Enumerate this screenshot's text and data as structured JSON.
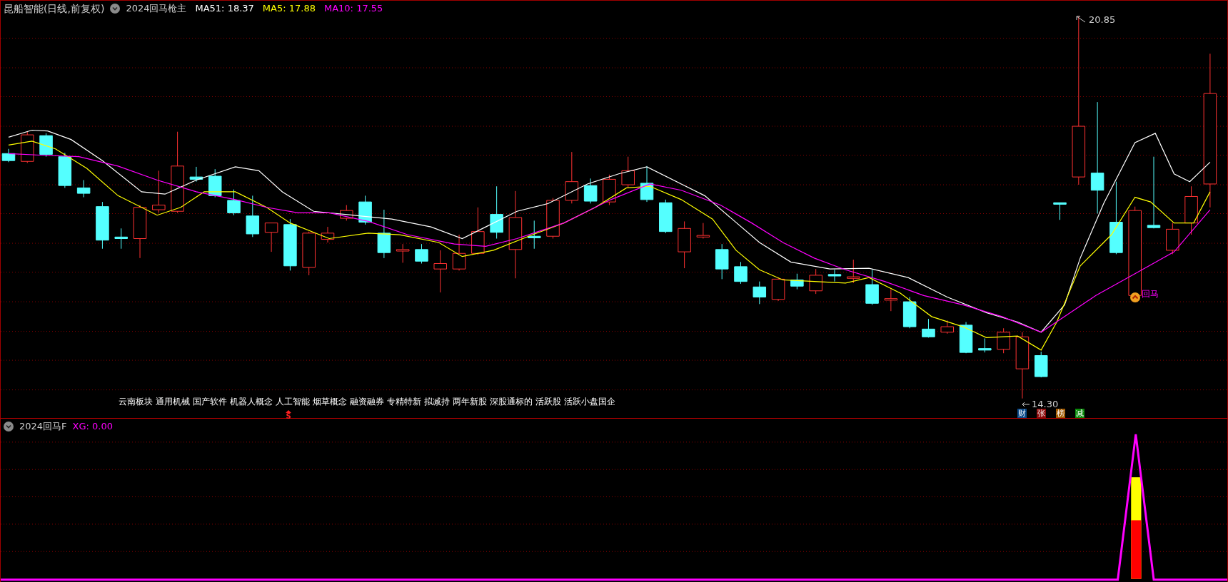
{
  "main_pane": {
    "title": "昆船智能(日线,前复权)",
    "indicator": "2024回马枪主",
    "legend": [
      {
        "label": "MA51: 18.37",
        "color": "#ffffff"
      },
      {
        "label": "MA5: 17.88",
        "color": "#ffff00"
      },
      {
        "label": "MA10: 17.55",
        "color": "#ff00ff"
      }
    ],
    "high_label": "20.85",
    "low_label": "14.30",
    "signal_label": "回马",
    "concepts": [
      "云南板块",
      "通用机械",
      "国产软件",
      "机器人概念",
      "人工智能",
      "烟草概念",
      "融资融券",
      "专精特新",
      "拟减持",
      "两年新股",
      "深股通标的",
      "活跃股",
      "活跃小盘国企"
    ],
    "marker": "S",
    "badges": [
      {
        "label": "财",
        "color": "#0a4a8a"
      },
      {
        "label": "张",
        "color": "#8a0a0a"
      },
      {
        "label": "榜",
        "color": "#a05a00"
      },
      {
        "label": "减",
        "color": "#0a8a0a"
      }
    ]
  },
  "sub_pane": {
    "indicator": "2024回马F",
    "reading": "XG: 0.00"
  }
}
